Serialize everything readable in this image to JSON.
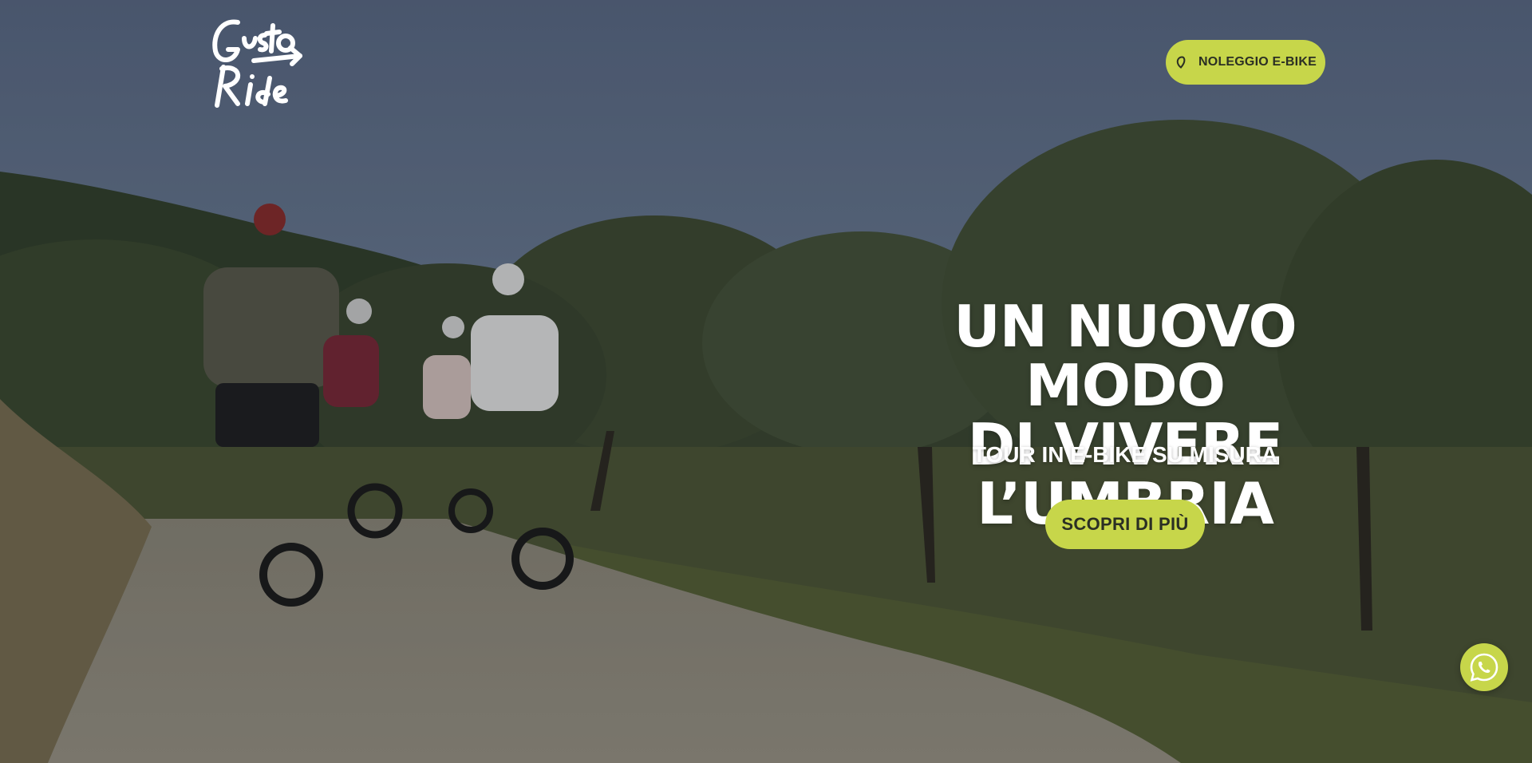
{
  "header": {
    "logo_alt": "Gusto Ride",
    "rent_button_label": "NOLEGGIO E-BIKE",
    "rent_icon": "map-pin-icon"
  },
  "hero": {
    "headline_line1": "UN NUOVO MODO",
    "headline_line2": "DI VIVERE L’UMBRIA",
    "subheadline": "TOUR IN E-BIKE SU MISURA",
    "cta_label": "SCOPRI DI PIÙ",
    "background_image": "cyclists-olive-grove-photo"
  },
  "floating": {
    "chat_icon": "whatsapp-icon"
  },
  "colors": {
    "accent": "#c7d64a",
    "accent_text": "#2b2f24",
    "headline": "#ffffff"
  }
}
